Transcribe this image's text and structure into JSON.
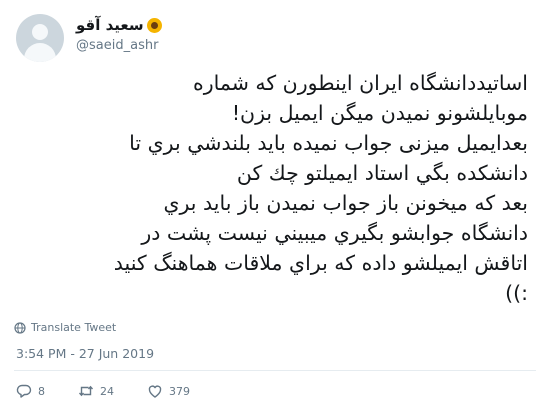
{
  "user": {
    "display_name": "سعيد آقو",
    "name_icon": "sunflower-icon",
    "handle": "@saeid_ashr",
    "avatar_icon": "default-avatar-icon"
  },
  "tweet": {
    "text": "اساتیددانشگاه ایران اینطورن که شماره\nموبایلشونو نمیدن میگن ایمیل بزن!\nبعدایمیل میزنی جواب نمیده باید بلندشي بري تا\nدانشکده بگي استاد ایمیلتو چك کن\nبعد که میخونن باز جواب نمیدن باز باید بري\nدانشگاه جوابشو بگیري میبیني نیست  پشت در\nاتاقش ایمیلشو داده که براي ملاقات هماهنگ کنید\n:))"
  },
  "translate_label": "Translate Tweet",
  "timestamp": "3:54 PM - 27 Jun 2019",
  "actions": {
    "reply_count": "8",
    "retweet_count": "24",
    "like_count": "379"
  },
  "colors": {
    "text": "#14171a",
    "secondary": "#657786",
    "divider": "#e6ecf0",
    "avatar_bg": "#ccd6dd"
  }
}
